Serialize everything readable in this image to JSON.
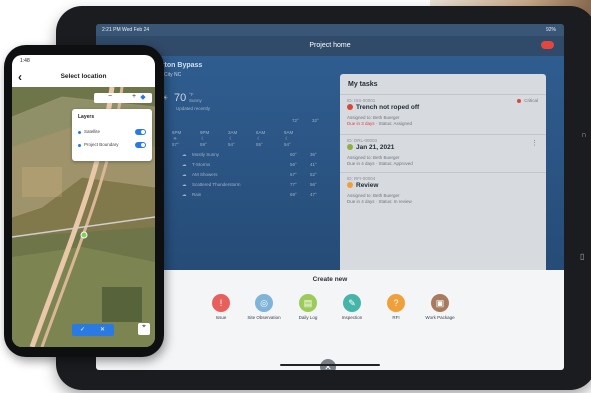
{
  "tablet": {
    "status_time": "2:21 PM  Wed Feb 24",
    "battery": "92%",
    "title": "Project home",
    "project": {
      "name_line1": "Exton Bypass",
      "name_line2": "Elm City NC"
    },
    "weather": {
      "temp": "70",
      "unit": "°F",
      "condition": "Sunny",
      "updated": "Updated recently"
    },
    "days": [
      "6PM",
      "9PM",
      "3AM",
      "6AM",
      "9AM"
    ],
    "day_temps": [
      "57°",
      "59°",
      "54°",
      "55°",
      "54°"
    ],
    "hi_lo": [
      "72°",
      "32°"
    ],
    "forecast": [
      {
        "label": "Mostly Sunny",
        "hi": "60°",
        "lo": "36°"
      },
      {
        "label": "T-Storms",
        "hi": "56°",
        "lo": "41°"
      },
      {
        "label": "AM Showers",
        "hi": "67°",
        "lo": "52°"
      },
      {
        "label": "Scattered Thunderstorm",
        "hi": "77°",
        "lo": "56°"
      },
      {
        "label": "Rain",
        "hi": "69°",
        "lo": "47°"
      }
    ],
    "tasks": {
      "heading": "My tasks",
      "items": [
        {
          "id": "ID: ISS-00001",
          "title": "Trench not roped off",
          "assigned": "Assigned to: Beth Buerger",
          "due": "Due in 3 days",
          "status": "Status: Assigned",
          "badge": "Critical",
          "color": "#d9473c"
        },
        {
          "id": "ID: DRL-00003",
          "title": "Jan 21, 2021",
          "assigned": "Assigned to: Beth Buerger",
          "due": "Due in 4 days",
          "status": "Status: Approved",
          "badge": "",
          "color": "#8db043"
        },
        {
          "id": "ID: RFI-00004",
          "title": "Review",
          "assigned": "Assigned to: Beth Buerger",
          "due": "Due in 4 days",
          "status": "Status: In review",
          "badge": "",
          "color": "#f0a03a"
        }
      ]
    },
    "create_new": {
      "title": "Create new",
      "options": [
        {
          "label": "Issue",
          "color": "#e8605b",
          "icon": "!"
        },
        {
          "label": "Site Observation",
          "color": "#7fb3d8",
          "icon": "◎"
        },
        {
          "label": "Daily Log",
          "color": "#9ccb5a",
          "icon": "▤"
        },
        {
          "label": "Inspection",
          "color": "#46b5a8",
          "icon": "✎"
        },
        {
          "label": "RFI",
          "color": "#f0a03a",
          "icon": "?"
        },
        {
          "label": "Work Package",
          "color": "#a97b5e",
          "icon": "▣"
        }
      ],
      "close": "✕"
    }
  },
  "phone": {
    "status_time": "1:48",
    "title": "Select location",
    "back": "‹",
    "zoom_minus": "−",
    "zoom_plus": "+",
    "layers": {
      "title": "Layers",
      "items": [
        {
          "label": "Satellite"
        },
        {
          "label": "Project Boundary"
        }
      ]
    },
    "confirm": "✓",
    "cancel": "✕"
  }
}
